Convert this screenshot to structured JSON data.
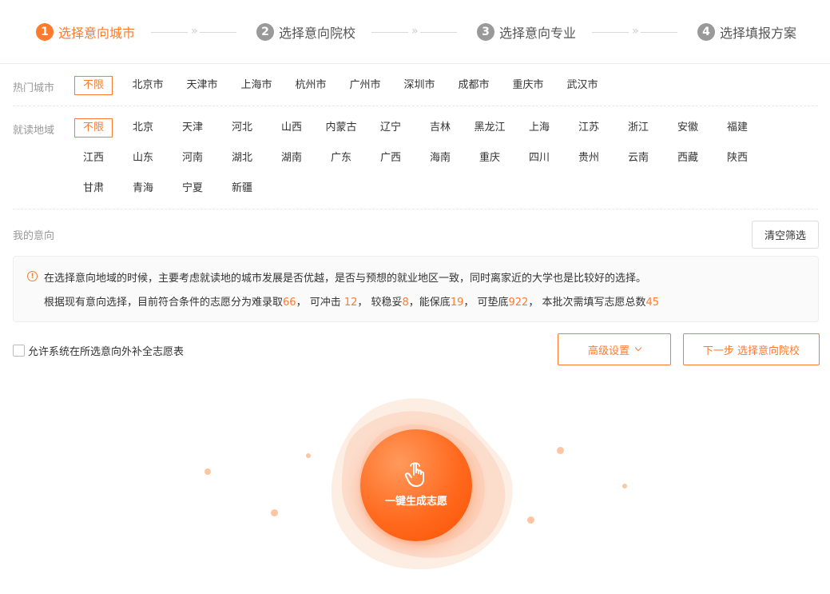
{
  "steps": [
    {
      "num": "1",
      "label": "选择意向城市"
    },
    {
      "num": "2",
      "label": "选择意向院校"
    },
    {
      "num": "3",
      "label": "选择意向专业"
    },
    {
      "num": "4",
      "label": "选择填报方案"
    }
  ],
  "step_separator": "»",
  "hot_cities": {
    "label": "热门城市",
    "options": [
      "不限",
      "北京市",
      "天津市",
      "上海市",
      "杭州市",
      "广州市",
      "深圳市",
      "成都市",
      "重庆市",
      "武汉市"
    ],
    "selected": "不限"
  },
  "regions": {
    "label": "就读地域",
    "options": [
      "不限",
      "北京",
      "天津",
      "河北",
      "山西",
      "内蒙古",
      "辽宁",
      "吉林",
      "黑龙江",
      "上海",
      "江苏",
      "浙江",
      "安徽",
      "福建",
      "江西",
      "山东",
      "河南",
      "湖北",
      "湖南",
      "广东",
      "广西",
      "海南",
      "重庆",
      "四川",
      "贵州",
      "云南",
      "西藏",
      "陕西",
      "甘肃",
      "青海",
      "宁夏",
      "新疆"
    ],
    "selected": "不限"
  },
  "mine": {
    "label": "我的意向",
    "clear_button": "清空筛选"
  },
  "tip": {
    "icon": "exclamation-circle-icon",
    "line1": "在选择意向地域的时候，主要考虑就读地的城市发展是否优越，是否与预想的就业地区一致，同时离家近的大学也是比较好的选择。",
    "line2_a": "根据现有意向选择，目前符合条件的志愿分为难录取",
    "hard": "66",
    "line2_b": "， 可冲击 ",
    "rush": "12",
    "line2_c": "， 较稳妥",
    "stable": "8",
    "line2_d": "，能保底",
    "safe": "19",
    "line2_e": "， 可垫底",
    "bottom": "922",
    "line2_f": "， 本批次需填写志愿总数",
    "total": "45"
  },
  "checkbox": {
    "label": "允许系统在所选意向外补全志愿表",
    "checked": false
  },
  "advanced_button": "高级设置",
  "next_button": "下一步 选择意向院校",
  "generate_button": "一键生成志愿",
  "colors": {
    "accent": "#ff7a2e",
    "step_inactive": "#999999",
    "muted_text": "#999999"
  }
}
